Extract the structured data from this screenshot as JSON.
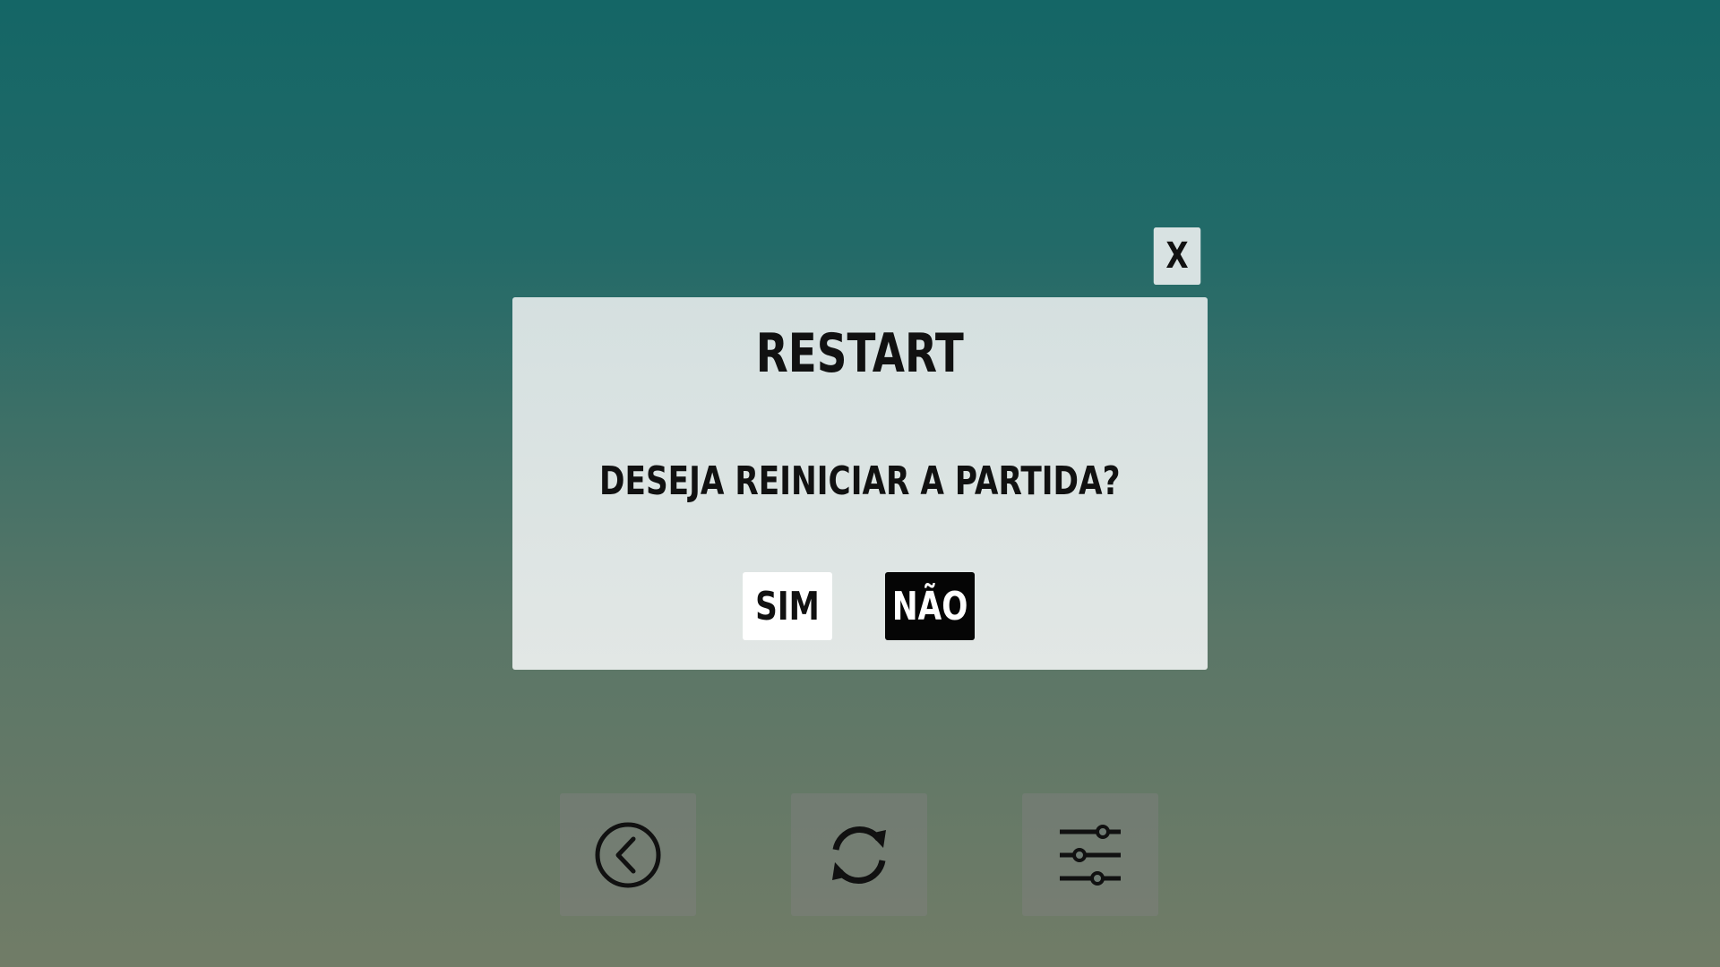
{
  "dialog": {
    "close_label": "X",
    "title": "RESTART",
    "message": "DESEJA REINICIAR A PARTIDA?",
    "yes_label": "SIM",
    "no_label": "NÃO"
  },
  "toolbar": {
    "buttons": [
      {
        "icon": "back-icon"
      },
      {
        "icon": "restart-icon"
      },
      {
        "icon": "settings-icon"
      }
    ]
  },
  "colors": {
    "background_top": "#146666",
    "background_bottom": "#717c67",
    "dialog_background": "#dde5e3",
    "yes_background": "#ffffff",
    "no_background": "#050505"
  }
}
